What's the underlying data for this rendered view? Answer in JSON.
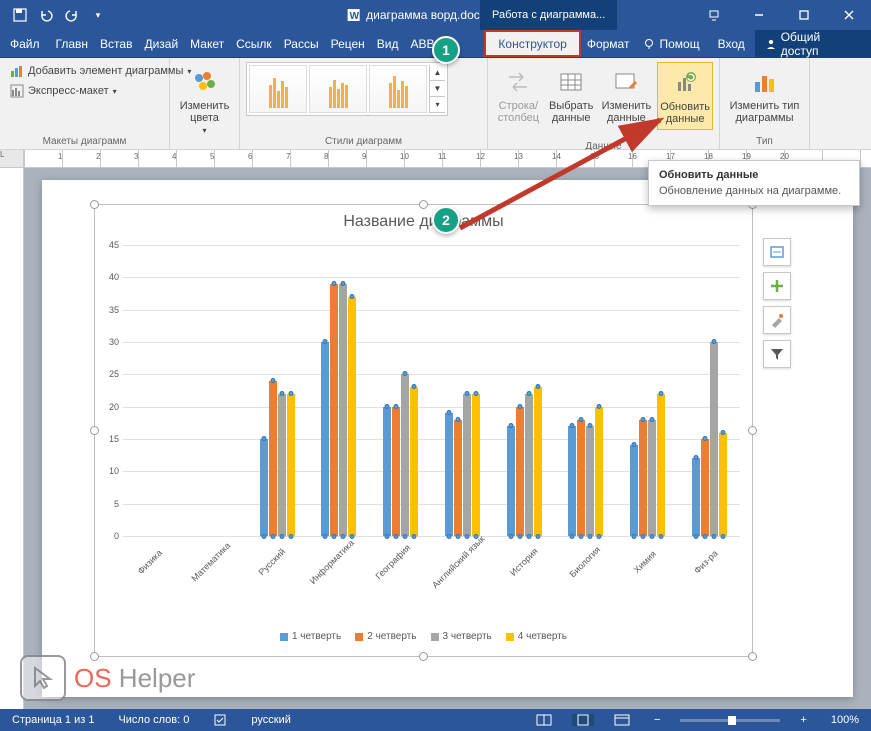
{
  "titlebar": {
    "doc_title": "диаграмма ворд.docx - Word",
    "tools_context": "Работа с диаграмма..."
  },
  "tabs": {
    "file": "Файл",
    "home": "Главн",
    "insert": "Встав",
    "design": "Дизай",
    "layout": "Макет",
    "references": "Ссылк",
    "mailings": "Рассы",
    "review": "Рецен",
    "view": "Вид",
    "abbyy": "ABB",
    "ctx1": "",
    "constructor": "Конструктор",
    "format": "Формат",
    "tell_me": "Помощ",
    "login": "Вход",
    "share": "Общий доступ"
  },
  "ribbon": {
    "add_element": "Добавить элемент диаграммы",
    "quick_layout": "Экспресс-макет",
    "group_layouts": "Макеты диаграмм",
    "change_colors": "Изменить цвета",
    "group_styles": "Стили диаграмм",
    "switch_rc": "Строка/столбец",
    "select_data": "Выбрать данные",
    "edit_data": "Изменить данные",
    "refresh_data": "Обновить данные",
    "group_data": "Данные",
    "change_type": "Изменить тип диаграммы",
    "group_type": "Тип"
  },
  "tooltip": {
    "title": "Обновить данные",
    "body": "Обновление данных на диаграмме."
  },
  "markers": {
    "m1": "1",
    "m2": "2"
  },
  "chart_data": {
    "type": "bar",
    "title": "Название диаграммы",
    "ylim": [
      0,
      45
    ],
    "yticks": [
      0,
      5,
      10,
      15,
      20,
      25,
      30,
      35,
      40,
      45
    ],
    "categories": [
      "Физика",
      "Математика",
      "Русский",
      "Информатика",
      "География",
      "Английский язык",
      "История",
      "Биология",
      "Химия",
      "Физ-ра"
    ],
    "series": [
      {
        "name": "1 четверть",
        "color": "#5b9bd5",
        "values": [
          0,
          0,
          15,
          30,
          20,
          19,
          17,
          17,
          14,
          12
        ]
      },
      {
        "name": "2 четверть",
        "color": "#ed7d31",
        "values": [
          0,
          0,
          24,
          39,
          20,
          18,
          20,
          18,
          18,
          15
        ]
      },
      {
        "name": "3 четверть",
        "color": "#a5a5a5",
        "values": [
          0,
          0,
          22,
          39,
          25,
          22,
          22,
          17,
          18,
          30
        ]
      },
      {
        "name": "4 четверть",
        "color": "#ffc000",
        "values": [
          0,
          0,
          22,
          37,
          23,
          22,
          23,
          20,
          22,
          16
        ]
      }
    ],
    "legend": [
      "1 четверть",
      "2 четверть",
      "3 четверть",
      "4 четверть"
    ]
  },
  "statusbar": {
    "page": "Страница 1 из 1",
    "words": "Число слов: 0",
    "language": "русский",
    "zoom": "100%"
  },
  "watermark": {
    "os": "OS",
    "helper": " Helper"
  }
}
